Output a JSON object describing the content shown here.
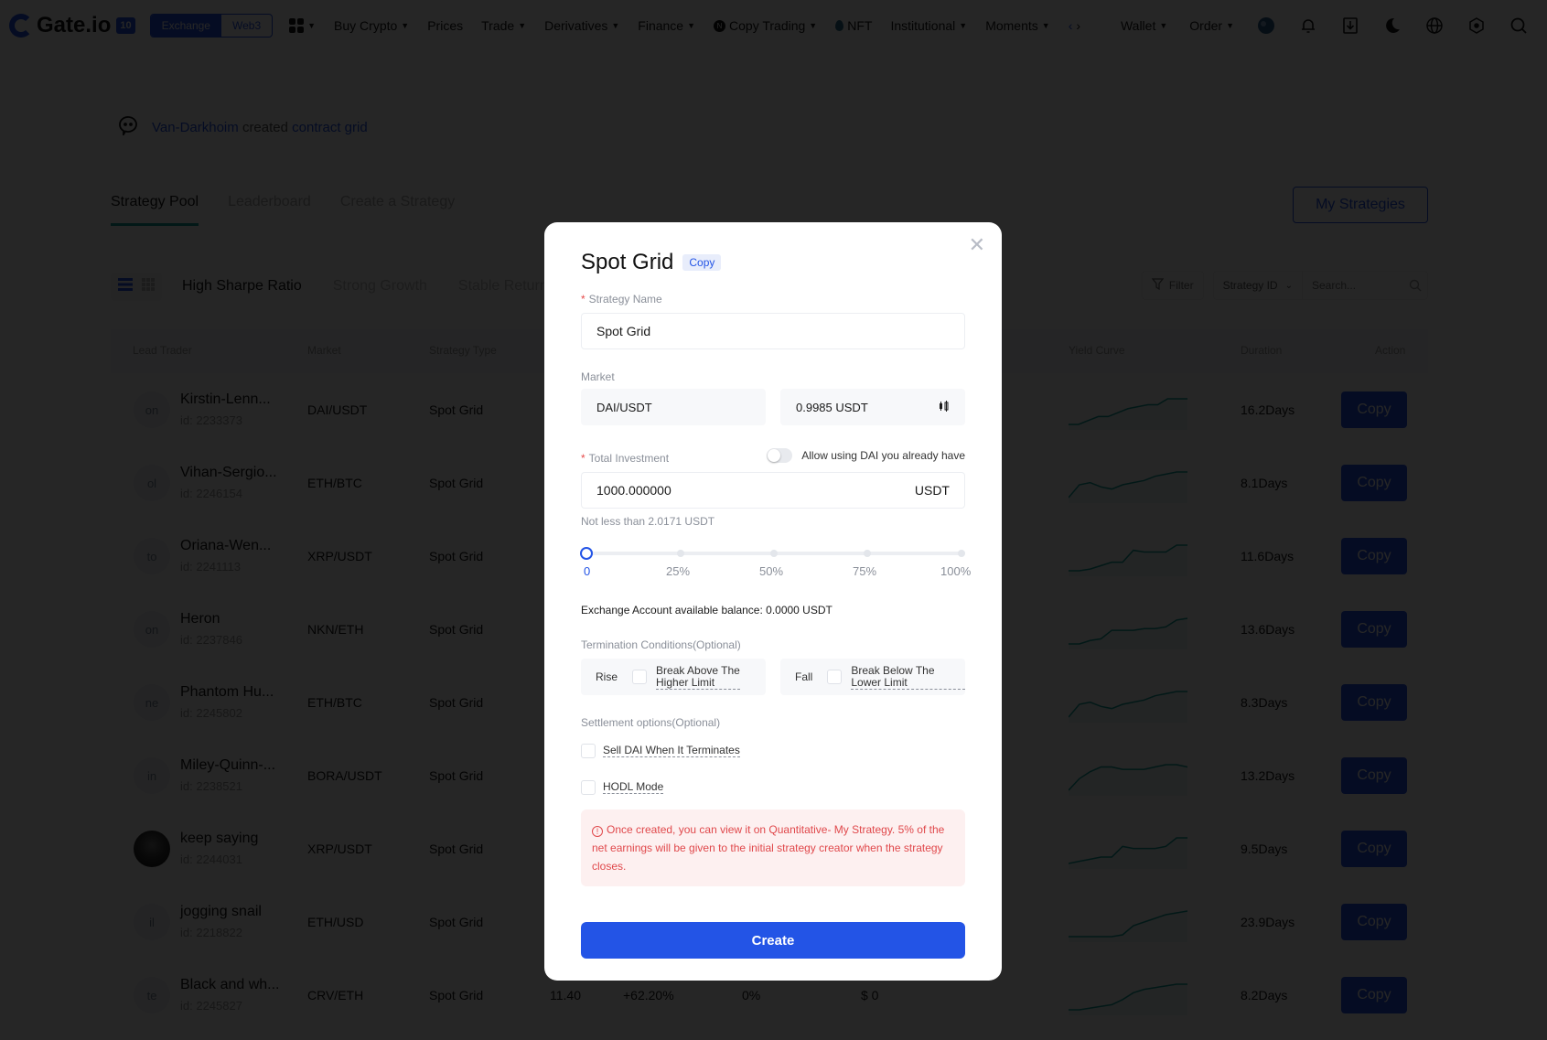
{
  "nav": {
    "logo_text": "Gate.io",
    "logo_badge": "10",
    "switch": [
      "Exchange",
      "Web3"
    ],
    "items": [
      {
        "label": "Buy Crypto",
        "caret": true
      },
      {
        "label": "Prices",
        "caret": false
      },
      {
        "label": "Trade",
        "caret": true
      },
      {
        "label": "Derivatives",
        "caret": true
      },
      {
        "label": "Finance",
        "caret": true
      },
      {
        "label": "Copy Trading",
        "caret": true
      },
      {
        "label": "NFT",
        "caret": false
      },
      {
        "label": "Institutional",
        "caret": true
      },
      {
        "label": "Moments",
        "caret": true
      }
    ],
    "right": {
      "wallet": "Wallet",
      "order": "Order"
    },
    "icons": [
      "avatar-icon",
      "bell-icon",
      "download-icon",
      "theme-icon",
      "globe-icon",
      "settings-icon",
      "search-icon"
    ]
  },
  "ticker": {
    "name": "Van-Darkhoim",
    "mid": "created",
    "link": "contract grid"
  },
  "tabs": [
    {
      "label": "Strategy Pool",
      "active": true
    },
    {
      "label": "Leaderboard",
      "active": false
    },
    {
      "label": "Create a Strategy",
      "active": false
    }
  ],
  "my_strategies_label": "My Strategies",
  "categories": [
    "High Sharpe Ratio",
    "Strong Growth",
    "Stable Returns"
  ],
  "filter": {
    "label": "Filter",
    "select": "Strategy ID",
    "search_placeholder": "Search..."
  },
  "table": {
    "headers": {
      "trader": "Lead Trader",
      "market": "Market",
      "type": "Strategy Type",
      "yield": "Yield Curve",
      "duration": "Duration",
      "action": "Action"
    },
    "copy_label": "Copy",
    "rows": [
      {
        "avatar": "on",
        "name": "Kirstin-Lenn...",
        "id": "id: 2233373",
        "market": "DAI/USDT",
        "type": "Spot Grid",
        "duration": "16.2Days",
        "curve": [
          0,
          0,
          2,
          4,
          4,
          6,
          8,
          9,
          10,
          10,
          13,
          13,
          13
        ]
      },
      {
        "avatar": "ol",
        "name": "Vihan-Sergio...",
        "id": "id: 2246154",
        "market": "ETH/BTC",
        "type": "Spot Grid",
        "duration": "8.1Days",
        "curve": [
          0,
          6,
          7,
          5,
          4,
          6,
          7,
          8,
          10,
          11,
          12,
          12
        ]
      },
      {
        "avatar": "to",
        "name": "Oriana-Wen...",
        "id": "id: 2241113",
        "market": "XRP/USDT",
        "type": "Spot Grid",
        "duration": "11.6Days",
        "curve": [
          0,
          0,
          1,
          3,
          5,
          5,
          12,
          11,
          11,
          11,
          15,
          15
        ]
      },
      {
        "avatar": "on",
        "name": "Heron",
        "id": "id: 2237846",
        "market": "NKN/ETH",
        "type": "Spot Grid",
        "duration": "13.6Days",
        "curve": [
          0,
          0,
          2,
          3,
          8,
          8,
          8,
          9,
          9,
          10,
          14,
          15
        ]
      },
      {
        "avatar": "ne",
        "name": "Phantom Hu...",
        "id": "id: 2245802",
        "market": "ETH/BTC",
        "type": "Spot Grid",
        "duration": "8.3Days",
        "curve": [
          0,
          6,
          7,
          5,
          4,
          6,
          7,
          8,
          10,
          11,
          12,
          12
        ]
      },
      {
        "avatar": "in",
        "name": "Miley-Quinn-...",
        "id": "id: 2238521",
        "market": "BORA/USDT",
        "type": "Spot Grid",
        "duration": "13.2Days",
        "curve": [
          0,
          5,
          8,
          10,
          10,
          9,
          9,
          9,
          10,
          11,
          11,
          10
        ]
      },
      {
        "avatar": "",
        "name": "keep saying",
        "id": "id: 2244031",
        "market": "XRP/USDT",
        "type": "Spot Grid",
        "duration": "9.5Days",
        "curve": [
          0,
          1,
          2,
          3,
          3,
          8,
          7,
          7,
          7,
          8,
          12,
          12
        ]
      },
      {
        "avatar": "il",
        "name": "jogging snail",
        "id": "id: 2218822",
        "market": "ETH/USD",
        "type": "Spot Grid",
        "duration": "23.9Days",
        "curve": [
          0,
          0,
          0,
          0,
          0,
          1,
          6,
          8,
          10,
          12,
          13,
          14
        ]
      },
      {
        "avatar": "te",
        "name": "Black and wh...",
        "id": "id: 2245827",
        "market": "CRV/ETH",
        "type": "Spot Grid",
        "duration": "8.2Days",
        "extra": [
          "11.40",
          "+62.20%",
          "0%",
          "$ 0"
        ],
        "curve": [
          0,
          0,
          1,
          2,
          3,
          6,
          10,
          12,
          13,
          14,
          15,
          15
        ]
      }
    ]
  },
  "modal": {
    "title": "Spot Grid",
    "tag": "Copy",
    "strategy_name_label": "Strategy Name",
    "strategy_name_value": "Spot Grid",
    "market_label": "Market",
    "market_pair": "DAI/USDT",
    "market_price": "0.9985 USDT",
    "total_investment_label": "Total Investment",
    "allow_label": "Allow using DAI you already have",
    "allow_enabled": false,
    "investment_value": "1000.000000",
    "investment_unit": "USDT",
    "min_hint": "Not less than 2.0171 USDT",
    "slider_percent": 0,
    "slider_marks": [
      "0",
      "25%",
      "50%",
      "75%",
      "100%"
    ],
    "balance": "Exchange Account available balance: 0.0000 USDT",
    "termination_label": "Termination Conditions(Optional)",
    "rise_label": "Rise",
    "rise_option": "Break Above The Higher Limit",
    "fall_label": "Fall",
    "fall_option": "Break Below The Lower Limit",
    "settlement_label": "Settlement options(Optional)",
    "sell_option": "Sell DAI When It Terminates",
    "hodl_option": "HODL Mode",
    "notice": "Once created, you can view it on Quantitative- My Strategy. 5% of the net earnings will be given to the initial strategy creator when the strategy closes.",
    "create_label": "Create"
  },
  "colors": {
    "accent": "#2354e6",
    "teal": "#11a39b",
    "danger": "#e0484b",
    "notice_bg": "#fdf0f0"
  }
}
